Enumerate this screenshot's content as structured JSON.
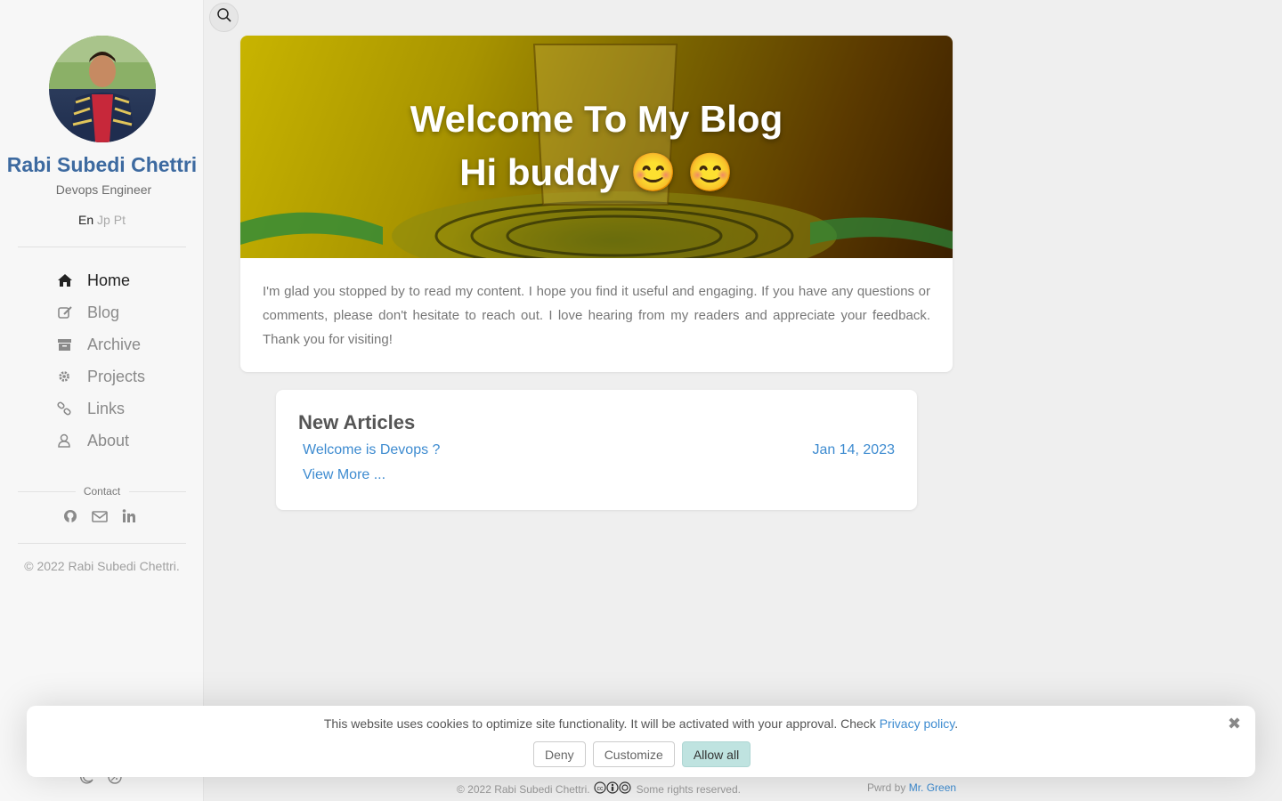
{
  "sidebar": {
    "author_name": "Rabi Subedi Chettri",
    "author_title": "Devops Engineer",
    "languages": [
      "En",
      "Jp",
      "Pt"
    ],
    "nav": [
      {
        "label": "Home",
        "icon": "home-icon"
      },
      {
        "label": "Blog",
        "icon": "edit-icon"
      },
      {
        "label": "Archive",
        "icon": "archive-icon"
      },
      {
        "label": "Projects",
        "icon": "gear-icon"
      },
      {
        "label": "Links",
        "icon": "link-icon"
      },
      {
        "label": "About",
        "icon": "user-icon"
      }
    ],
    "contact_label": "Contact",
    "copyright": "© 2022 Rabi Subedi Chettri."
  },
  "banner": {
    "title_line1": "Welcome To My Blog",
    "title_line2": "Hi buddy 😊 😊",
    "text": "I'm glad you stopped by to read my content. I hope you find it useful and engaging. If you have any questions or comments, please don't hesitate to reach out. I love hearing from my readers and appreciate your feedback. Thank you for visiting!"
  },
  "articles": {
    "title": "New Articles",
    "items": [
      {
        "title": "Welcome is Devops ?",
        "date": "Jan 14, 2023"
      }
    ],
    "view_more": "View More ..."
  },
  "footer": {
    "copyright": "© 2022 Rabi Subedi Chettri.",
    "rights": "Some rights reserved.",
    "pwrd_prefix": "Pwrd by",
    "pwrd_link": "Mr. Green"
  },
  "cookie": {
    "text": "This website uses cookies to optimize site functionality. It will be activated with your approval. Check",
    "link": "Privacy policy",
    "suffix": ".",
    "deny": "Deny",
    "customize": "Customize",
    "allow": "Allow all"
  }
}
